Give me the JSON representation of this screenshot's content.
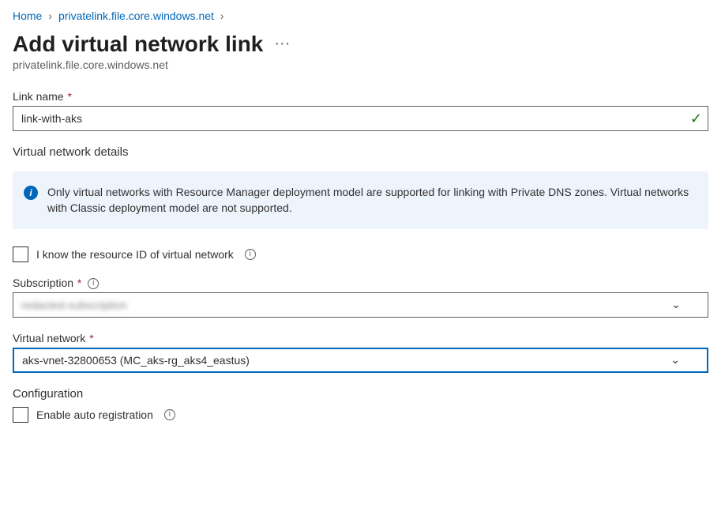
{
  "breadcrumb": {
    "home": "Home",
    "zone": "privatelink.file.core.windows.net"
  },
  "pageTitle": "Add virtual network link",
  "pageSubtitle": "privatelink.file.core.windows.net",
  "linkName": {
    "label": "Link name",
    "value": "link-with-aks"
  },
  "vnetDetails": {
    "heading": "Virtual network details",
    "banner": "Only virtual networks with Resource Manager deployment model are supported for linking with Private DNS zones. Virtual networks with Classic deployment model are not supported."
  },
  "knowResourceId": {
    "label": "I know the resource ID of virtual network",
    "checked": false
  },
  "subscription": {
    "label": "Subscription",
    "value": "redacted-subscription"
  },
  "virtualNetwork": {
    "label": "Virtual network",
    "value": "aks-vnet-32800653 (MC_aks-rg_aks4_eastus)"
  },
  "configuration": {
    "heading": "Configuration",
    "autoRegistration": {
      "label": "Enable auto registration",
      "checked": false
    }
  }
}
